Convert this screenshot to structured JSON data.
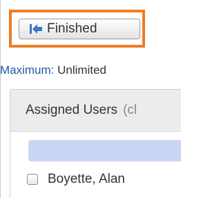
{
  "toolbar": {
    "finished_label": "Finished",
    "finished_icon": "skip-to-start-icon",
    "highlight_color": "#ee7d25"
  },
  "limits": {
    "maximum_label": "Maximum:",
    "maximum_value": "Unlimited"
  },
  "assigned_users": {
    "title": "Assigned Users",
    "hint": "(cl",
    "highlight_color": "#c9d6f3",
    "users": [
      {
        "name": "Boyette, Alan",
        "checked": false
      }
    ]
  }
}
